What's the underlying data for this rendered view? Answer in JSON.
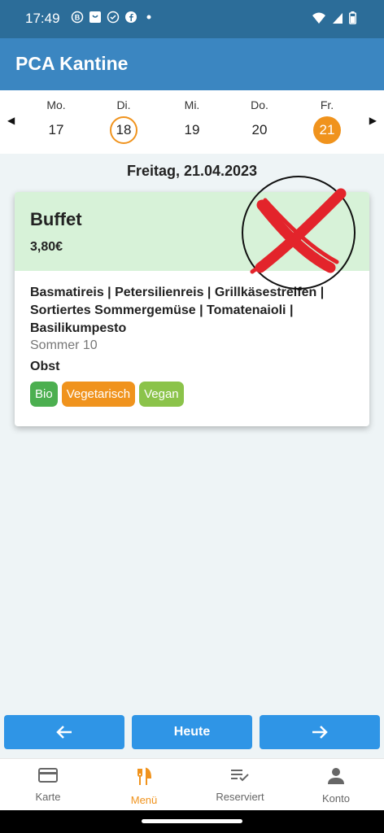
{
  "status_bar": {
    "time": "17:49",
    "notification_icons": [
      "b-circle-icon",
      "shopping-bag-icon",
      "check-circle-icon",
      "facebook-icon",
      "dot-icon"
    ],
    "system_icons": [
      "wifi-icon",
      "signal-icon",
      "battery-icon"
    ]
  },
  "app": {
    "title": "PCA Kantine",
    "accent": "#f0931d",
    "primary": "#3b86c1"
  },
  "week": [
    {
      "weekday": "Mo.",
      "day": "17",
      "state": "normal"
    },
    {
      "weekday": "Di.",
      "day": "18",
      "state": "today"
    },
    {
      "weekday": "Mi.",
      "day": "19",
      "state": "normal"
    },
    {
      "weekday": "Do.",
      "day": "20",
      "state": "normal"
    },
    {
      "weekday": "Fr.",
      "day": "21",
      "state": "selected"
    }
  ],
  "selected_date": "Freitag, 21.04.2023",
  "meal": {
    "name": "Buffet",
    "price": "3,80€",
    "description": "Basmatireis | Petersilienreis | Grillkäsestreifen | Sortiertes Sommergemüse | Tomatenaioli | Basilikumpesto",
    "location": "Sommer 10",
    "side": "Obst",
    "sold_out_mark": "red-x-icon",
    "tags": [
      {
        "label": "Bio",
        "color": "#4caf50"
      },
      {
        "label": "Vegetarisch",
        "color": "#f0931d"
      },
      {
        "label": "Vegan",
        "color": "#8bc34a"
      }
    ]
  },
  "nav_buttons": {
    "prev_icon": "arrow-left-icon",
    "today": "Heute",
    "next_icon": "arrow-right-icon"
  },
  "bottom_nav": [
    {
      "label": "Karte",
      "icon": "card-icon",
      "active": false
    },
    {
      "label": "Menü",
      "icon": "cutlery-icon",
      "active": true
    },
    {
      "label": "Reserviert",
      "icon": "list-check-icon",
      "active": false
    },
    {
      "label": "Konto",
      "icon": "person-icon",
      "active": false
    }
  ]
}
